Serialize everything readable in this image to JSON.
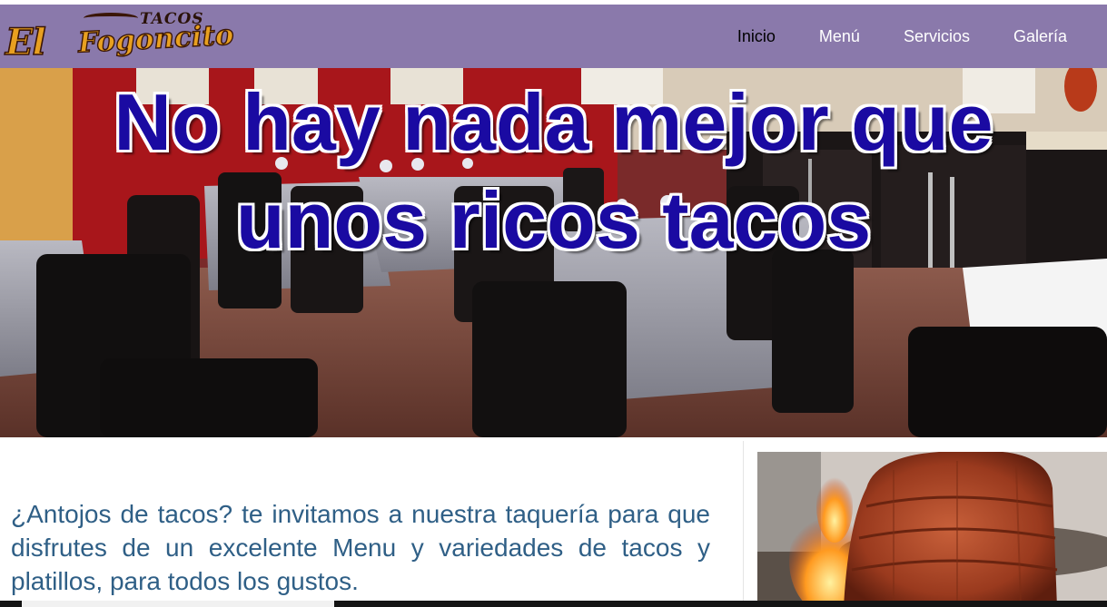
{
  "logo": {
    "top_text": "TACOS",
    "main_text_1": "El",
    "main_text_2": "Fogoncito"
  },
  "nav": {
    "items": [
      {
        "label": "Inicio",
        "active": true
      },
      {
        "label": "Menú",
        "active": false
      },
      {
        "label": "Servicios",
        "active": false
      },
      {
        "label": "Galería",
        "active": false
      }
    ]
  },
  "hero": {
    "heading_line_1": "No hay nada mejor que",
    "heading_line_2": "unos ricos tacos"
  },
  "intro": {
    "text": "¿Antojos de tacos? te invitamos a nuestra taquería para que disfrutes de un excelente Menu y variedades de tacos y platillos, para todos los gustos."
  },
  "colors": {
    "navbar": "#8a79ab",
    "heading": "#1a0aa2",
    "intro_text": "#2f5f86"
  },
  "icons": {
    "hero_image": "restaurant-dining-room-photo",
    "side_image": "tacos-al-pastor-trompo-photo"
  }
}
